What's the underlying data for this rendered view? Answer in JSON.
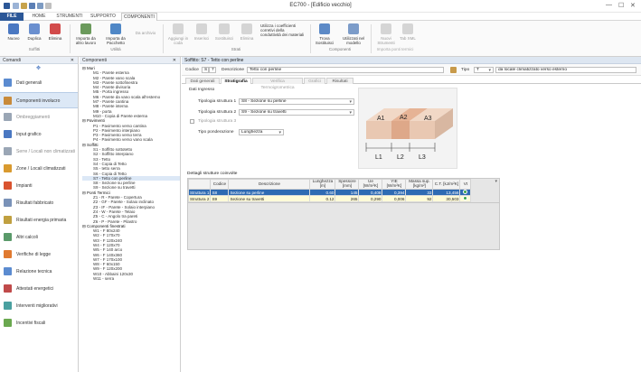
{
  "app": {
    "title": "EC700 - [Edificio vecchio]"
  },
  "tabs": [
    "FILE",
    "HOME",
    "STRUMENTI",
    "SUPPORTO",
    "COMPONENTI"
  ],
  "ribbon": {
    "buttons": [
      {
        "label": "Nuovo"
      },
      {
        "label": "Duplica"
      },
      {
        "label": "Elimina"
      },
      {
        "label": "Importa da altro lavoro"
      },
      {
        "label": "Importa da Pacchetto"
      },
      {
        "label": "Da archivio"
      },
      {
        "label": "Aggiungi in coda"
      },
      {
        "label": "Inserisci"
      },
      {
        "label": "Sostituisci"
      },
      {
        "label": "Elimina"
      },
      {
        "label": "Utilizza i coefficienti corretivi della conduttività dei materiali"
      },
      {
        "label": "Trova Sostituisci"
      },
      {
        "label": "Utilizzati nel modello"
      },
      {
        "label": "Nuovi Strumenti"
      },
      {
        "label": "Tab XML"
      }
    ],
    "groups": [
      "Soffitti",
      "Utilità",
      "Strati",
      "Componenti",
      "Importa ponti termici"
    ]
  },
  "left": {
    "header": "Comandi",
    "items": [
      "Dati generali",
      "Componenti involucro",
      "Ombreggiamenti",
      "Input grafico",
      "Serre / Locali non climatizzati",
      "Zone / Locali climatizzati",
      "Impianti",
      "Risultati fabbricato",
      "Risultati energia primaria",
      "Altri calcoli",
      "Verifiche di legge",
      "Relazione tecnica",
      "Attestati energetici",
      "Interventi migliorativi",
      "Incentivi fiscali"
    ]
  },
  "tree": {
    "header": "Componenti",
    "groups": [
      {
        "name": "Muri",
        "items": [
          "M1 - Parete esterna",
          "M2 - Parete vano scala",
          "M3 - Parete sottofinestra",
          "M4 - Parete divisoria",
          "M5 - Porta ingresso",
          "M6 - Parete da vano scala all'esterno",
          "M7 - Parete cantina",
          "M8 - Parete interna",
          "M9 - porta",
          "M10 - Copia di Parete esterna"
        ]
      },
      {
        "name": "Pavimenti",
        "items": [
          "P1 - Pavimento verso cantina",
          "P2 - Pavimento interpiano",
          "P3 - Pavimento verso terra",
          "P4 - Pavimento verso vano scala"
        ]
      },
      {
        "name": "Soffitti",
        "items": [
          "S1 - Soffitto sottotetto",
          "S2 - Soffitto interpiano",
          "S3 - Tetto",
          "S4 - Copia di Tetto",
          "S5 - tetto serra",
          "S6 - Copia di Tetto",
          "S7 - Tetto con perline",
          "S8 - Sezione su perline",
          "S9 - Sezione su travetti"
        ]
      },
      {
        "name": "Ponti Termici",
        "items": [
          "Z1 - R - Parete - Copertura",
          "Z2 - GF - Parete - Solaio inclinato",
          "Z3 - IF - Parete - Solaio interpiano",
          "Z4 - W - Parete - Telaio",
          "Z5 - C - Angolo tra pareti",
          "Z6 - P - Parete - Pilastro"
        ]
      },
      {
        "name": "Componenti finestrati",
        "items": [
          "W1 - F 80x240",
          "W2 - F 170x70",
          "W3 - F 120x240",
          "W4 - F 120x70",
          "W5 - F 140 arco",
          "W6 - F 140x360",
          "W7 - F 170x100",
          "W8 - F 60x150",
          "W9 - F 120x200",
          "W10 - Abbaini 120x30",
          "W11 - serra"
        ]
      }
    ]
  },
  "main": {
    "header": "Soffitto: S7 - Tetto con perline",
    "codice_label": "Codice",
    "codice": "S",
    "codice_num": "7",
    "descr_label": "Descrizione",
    "descr": "Tetto con perline",
    "tipo_label": "Tipo",
    "tipo": "T",
    "tipo_descr": "da locale climatizzato verso esterno",
    "subtabs": [
      "Dati generali",
      "Stratigrafia",
      "Verifica Termoigrometrica",
      "Grafici",
      "Risultati"
    ],
    "dati_ingresso": "Dati Ingresso",
    "tip1_label": "Tipologia struttura 1",
    "tip1": "S8 - Sezione su perline",
    "tip2_label": "Tipologia struttura 2",
    "tip2": "S9 - Sezione su travetti",
    "tip3_label": "Tipologia struttura 3",
    "pond_label": "Tipo ponderazione",
    "pond": "Lunghezza",
    "diagram": {
      "a1": "A1",
      "a2": "A2",
      "a3": "A3",
      "l1": "L1",
      "l2": "L2",
      "l3": "L3"
    },
    "grid_title": "Dettagli strutture coinvolte",
    "columns": [
      "",
      "Codice",
      "Descrizione",
      "Lunghezza [m]",
      "Spessore [mm]",
      "Ue [W/m²K]",
      "YIE [W/m²K]",
      "Massa sup. [kg/m²]",
      "C.T. [kJ/m²K]",
      "Vt"
    ],
    "rows": [
      {
        "name": "Struttura 1",
        "codice": "S8",
        "descr": "Sezione su perline",
        "lung": "0.60",
        "spess": "145",
        "ue": "0,408",
        "yie": "0,394",
        "massa": "33",
        "ct": "13,456"
      },
      {
        "name": "Struttura 2",
        "codice": "S9",
        "descr": "Sezione su travetti",
        "lung": "0.12",
        "spess": "265",
        "ue": "0,290",
        "yie": "0,006",
        "massa": "92",
        "ct": "30,503"
      }
    ]
  },
  "colors": {
    "accent": "#2b5797",
    "selection": "#2f6bb3"
  }
}
